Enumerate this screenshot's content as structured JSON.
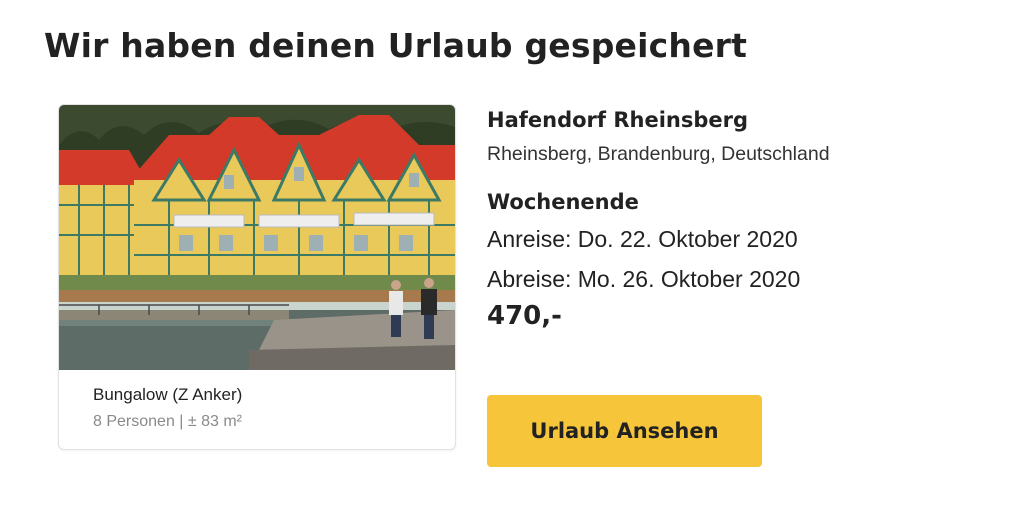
{
  "page": {
    "title": "Wir haben deinen Urlaub gespeichert"
  },
  "accommodation": {
    "image_alt": "photo-holiday-bungalows-at-harbor",
    "unit_name": "Bungalow (Z Anker)",
    "unit_meta": "8 Personen | ± 83 m²"
  },
  "details": {
    "park_name": "Hafendorf Rheinsberg",
    "location": "Rheinsberg, Brandenburg, Deutschland",
    "stay_type": "Wochenende",
    "arrival": "Anreise: Do. 22. Oktober 2020",
    "departure": "Abreise: Mo. 26. Oktober 2020",
    "price": "470,-"
  },
  "actions": {
    "view_button_label": "Urlaub Ansehen"
  },
  "colors": {
    "accent_button": "#f6c53a",
    "roof_red": "#d43a2a",
    "wall_yellow": "#e9c95a",
    "timber_green": "#3d7a66"
  }
}
